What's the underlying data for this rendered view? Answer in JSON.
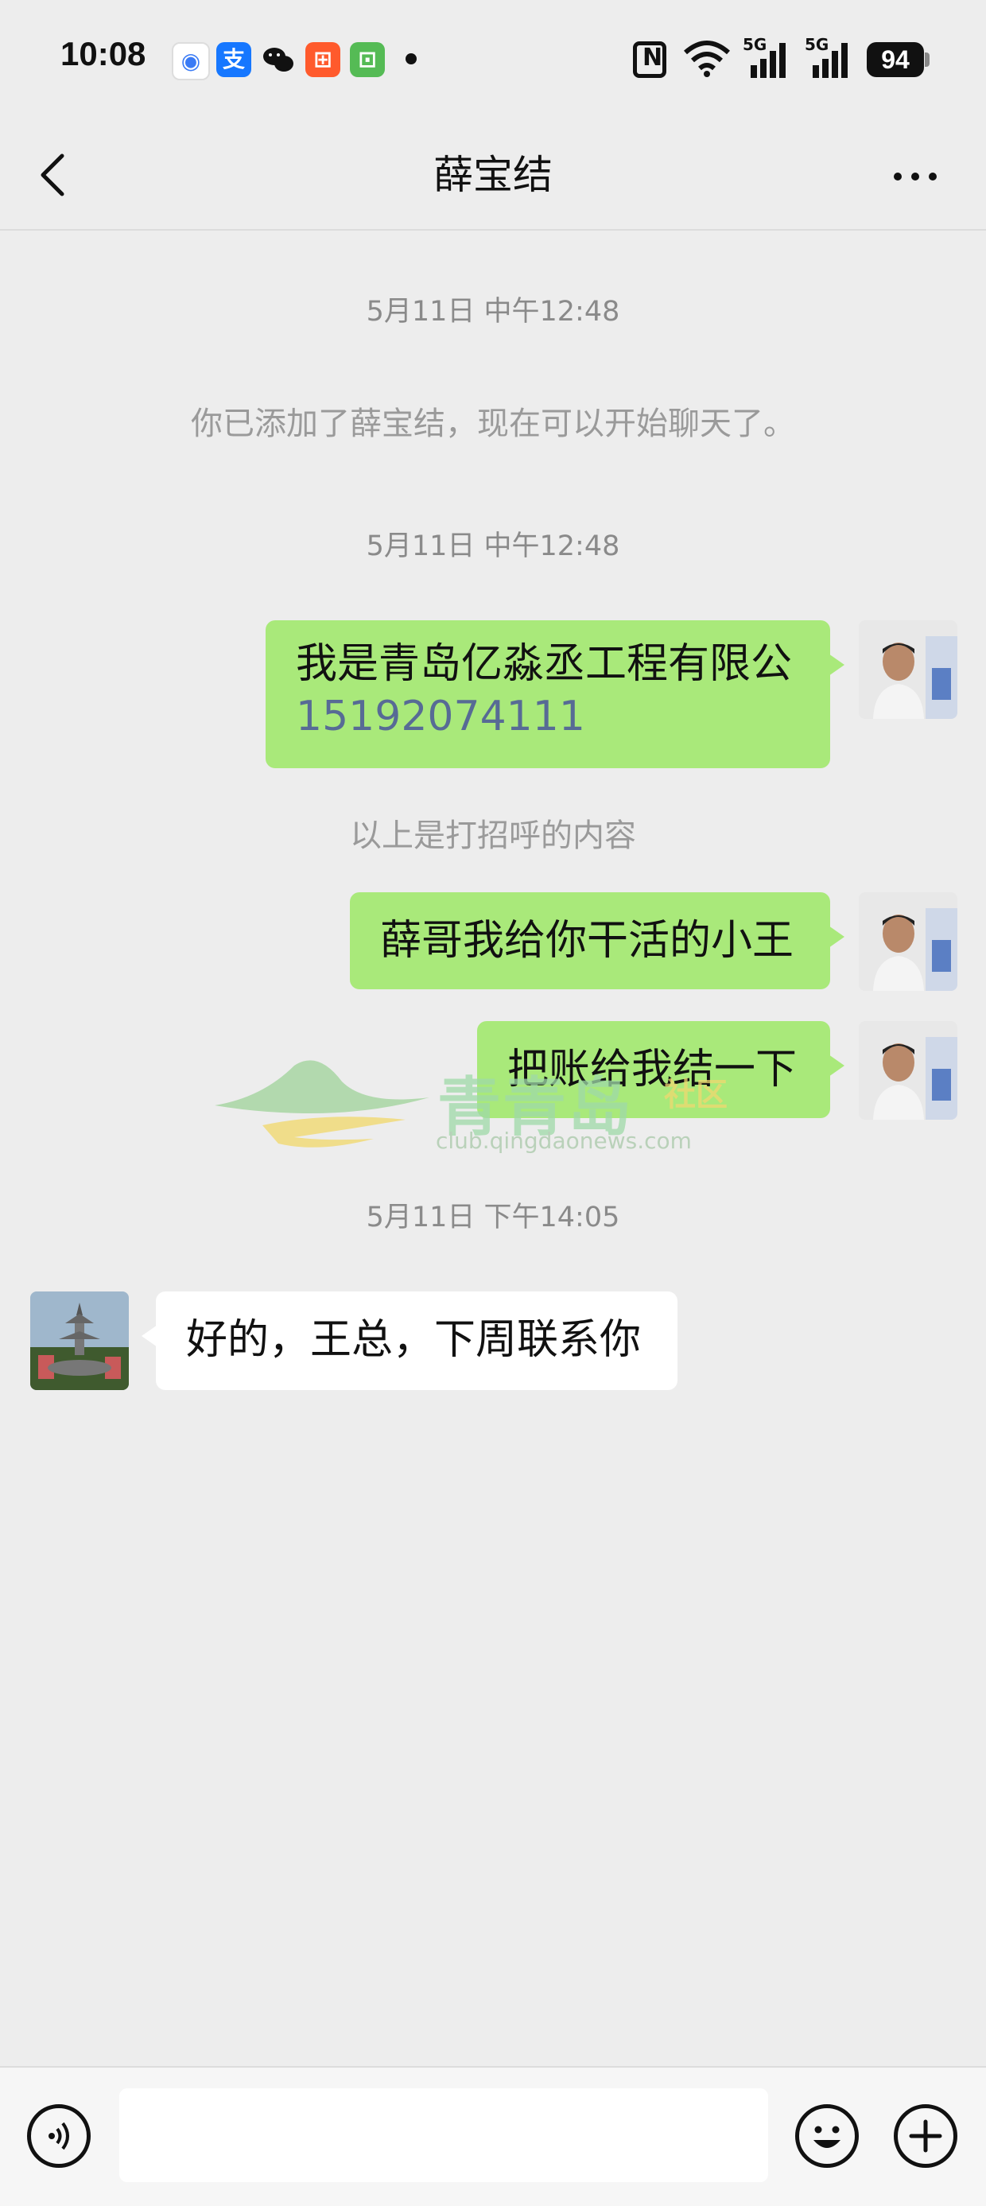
{
  "status_bar": {
    "time": "10:08",
    "apps": [
      {
        "icon": "qq-browser-icon",
        "glyph": "◉",
        "color": "#ffffff"
      },
      {
        "icon": "alipay-icon",
        "glyph": "支",
        "color": "#1677ff"
      },
      {
        "icon": "wechat-icon",
        "glyph": "●",
        "color": "#ffffff"
      },
      {
        "icon": "kuaishou-icon",
        "glyph": "⊞",
        "color": "#ff5a2c"
      },
      {
        "icon": "app-store-icon",
        "glyph": "⊡",
        "color": "#55bb55"
      }
    ],
    "network_1": "5G",
    "network_2": "5G",
    "battery": "94"
  },
  "nav": {
    "title": "薛宝结"
  },
  "messages": {
    "ts1": "5月11日 中午12:48",
    "system": "你已添加了薛宝结，现在可以开始聊天了。",
    "ts2": "5月11日 中午12:48",
    "out1_line1": "我是青岛亿淼丞工程有限公",
    "out1_phone": "15192074111",
    "greeting_note": "以上是打招呼的内容",
    "out2": "薛哥我给你干活的小王",
    "out3": "把账给我结一下",
    "ts3": "5月11日 下午14:05",
    "in1": "好的，王总，下周联系你"
  },
  "watermark": {
    "brand": "青青岛",
    "suffix": "社区",
    "url": "club.qingdaonews.com"
  },
  "input": {
    "value": ""
  }
}
